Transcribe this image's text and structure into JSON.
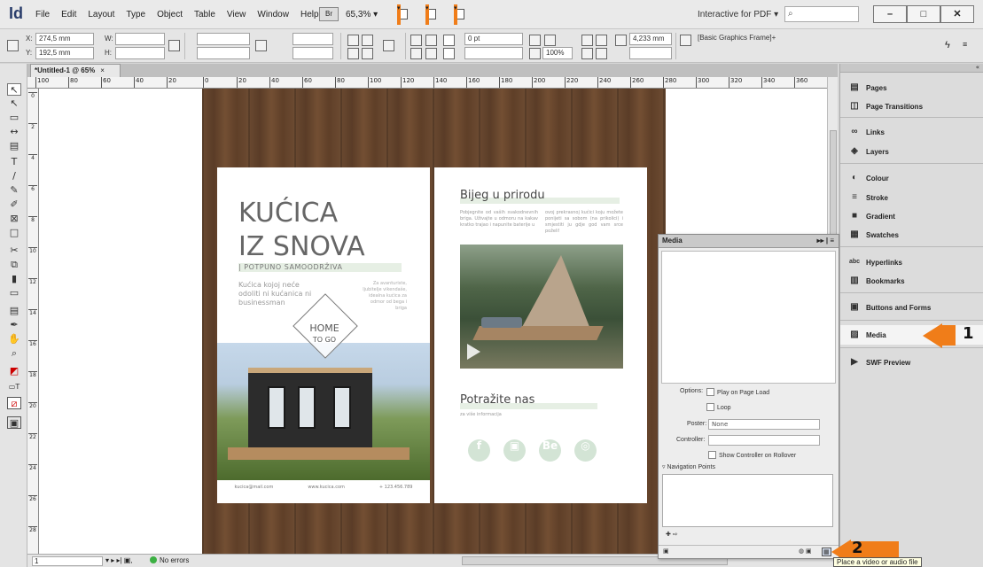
{
  "app": {
    "logo": "Id",
    "menus": [
      "File",
      "Edit",
      "Layout",
      "Type",
      "Object",
      "Table",
      "View",
      "Window",
      "Help"
    ],
    "br_label": "Br",
    "zoom": "65,3% ▾",
    "workspace": "Interactive for PDF ▾",
    "search_placeholder": "⌕",
    "window_buttons": [
      "–",
      "□",
      "✕"
    ]
  },
  "control": {
    "x_label": "X:",
    "x_value": "274,5 mm",
    "y_label": "Y:",
    "y_value": "192,5 mm",
    "w_label": "W:",
    "h_label": "H:",
    "stroke_weight": "0 pt",
    "opacity": "100%",
    "gap_value": "4,233 mm",
    "object_style": "[Basic Graphics Frame]+"
  },
  "document": {
    "tab_label": "*Untitled-1 @ 65%",
    "tab_close": "×",
    "ruler_ticks": [
      "100",
      "80",
      "60",
      "40",
      "20",
      "0",
      "20",
      "40",
      "60",
      "80",
      "100",
      "120",
      "140",
      "160",
      "180",
      "200",
      "220",
      "240",
      "260",
      "280",
      "300",
      "320",
      "340",
      "360"
    ],
    "vruler_ticks": [
      "0",
      "2",
      "4",
      "6",
      "8",
      "10",
      "12",
      "14",
      "16",
      "18",
      "20",
      "22",
      "24",
      "26",
      "28"
    ]
  },
  "page1": {
    "title_line1": "KUĆICA",
    "title_line2": "IZ SNOVA",
    "subtitle": "| POTPUNO SAMOODRŽIVA",
    "tagline": "Kućica kojoj neće odoliti ni kućanica ni businessman",
    "sidenote": "Za avanturiste, ljubitelje vikendaše, idealna kućica za odmor od bega i briga",
    "badge_home": "HOME",
    "badge_togo": "TO GO",
    "footer": [
      "kucica@mail.com",
      "www.kucica.com",
      "+ 123.456.789"
    ]
  },
  "page2": {
    "heading": "Bijeg u prirodu",
    "col1": "Pobjegnite od vaših svakodnevnih briga. Uživajte u odmoru na kakav kratko trajao i napunite baterije u",
    "col2": "ovoj prekrasnoj kućici koju možete ponijeti sa sobom (na prikolici) i smjestiti ju gdje god vam srce poželi!",
    "heading2": "Potražite nas",
    "heading2_sub": "za više informacija",
    "social": [
      "f",
      "▣",
      "Be",
      "◎"
    ]
  },
  "media_panel": {
    "title": "Media",
    "header_controls": "▸▸ | ≡",
    "options_label": "Options:",
    "play_on_load": "Play on Page Load",
    "loop": "Loop",
    "poster_label": "Poster:",
    "poster_value": "None",
    "controller_label": "Controller:",
    "controller_value": "",
    "show_controller": "Show Controller on Rollover",
    "nav_points": "Navigation Points"
  },
  "right_panel": {
    "collapse": "«",
    "items": [
      {
        "label": "Pages",
        "icon": "▤"
      },
      {
        "label": "Page Transitions",
        "icon": "◫"
      },
      {
        "label": "Links",
        "icon": "∞"
      },
      {
        "label": "Layers",
        "icon": "◈"
      },
      {
        "label": "Colour",
        "icon": "◐"
      },
      {
        "label": "Stroke",
        "icon": "≡"
      },
      {
        "label": "Gradient",
        "icon": "■"
      },
      {
        "label": "Swatches",
        "icon": "▦"
      },
      {
        "label": "Hyperlinks",
        "icon": "abc"
      },
      {
        "label": "Bookmarks",
        "icon": "▥"
      },
      {
        "label": "Buttons and Forms",
        "icon": "▣"
      },
      {
        "label": "Media",
        "icon": "▨"
      },
      {
        "label": "SWF Preview",
        "icon": "▶"
      }
    ]
  },
  "status": {
    "page_field": "1",
    "nav": "▾ ▸ ▸| ▣,",
    "errors": "No errors"
  },
  "callouts": {
    "one": "1",
    "two": "2",
    "tooltip": "Place a video or audio file",
    "accent": "#f07d19"
  }
}
